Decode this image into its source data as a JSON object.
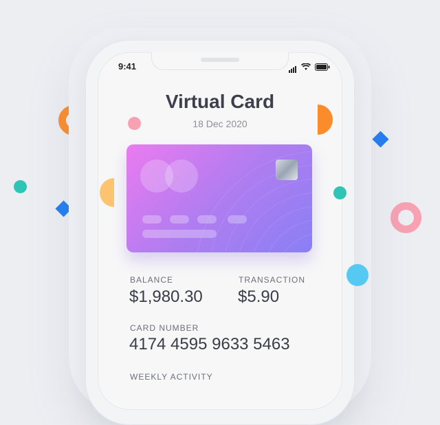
{
  "status_bar": {
    "time": "9:41"
  },
  "header": {
    "title": "Virtual Card",
    "date": "18 Dec 2020"
  },
  "stats": {
    "balance_label": "BALANCE",
    "balance_value": "$1,980.30",
    "transaction_label": "TRANSACTION",
    "transaction_value": "$5.90"
  },
  "card_number": {
    "label": "CARD NUMBER",
    "value": "4174 4595 9633 5463"
  },
  "activity": {
    "label": "WEEKLY ACTIVITY"
  },
  "colors": {
    "orange": "#fb8c2c",
    "pink": "#f7a1b2",
    "teal": "#2ec4b6",
    "blue": "#1e7cf0",
    "light_blue": "#56c9f3",
    "card_gradient": [
      "#ea7bf0",
      "#8a7ff5"
    ]
  },
  "icons": [
    "signal-icon",
    "wifi-icon",
    "battery-icon",
    "card-brand-logo-icon",
    "card-chip-icon"
  ]
}
